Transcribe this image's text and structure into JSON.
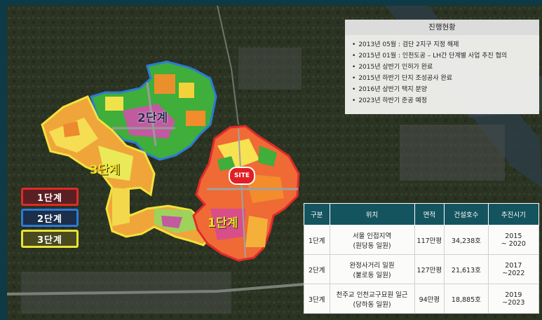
{
  "legend": {
    "phase1": "1단계",
    "phase2": "2단계",
    "phase3": "3단계"
  },
  "map_labels": {
    "phase1": "1단계",
    "phase2": "2단계",
    "phase3": "3단계",
    "site": "SITE"
  },
  "status": {
    "title": "진행현황",
    "items": [
      "2013년 05월 : 검단 2지구 지정 해제",
      "2015년 01월 : 인천도공 – LH간 단계별 사업 추진 협의",
      "2015년 상반기 인허가 완료",
      "2015년 하반기 단지 조성공사 완료",
      "2016년 상반기 택지 분양",
      "2023년 하반기 준공 예정"
    ]
  },
  "table": {
    "headers": [
      "구분",
      "위치",
      "면적",
      "건설호수",
      "추진시기"
    ],
    "rows": [
      {
        "phase": "1단계",
        "loc1": "서울 인접지역",
        "loc2": "(원당동 일원)",
        "area": "117만평",
        "units": "34,238호",
        "period1": "2015",
        "period2": "~ 2020"
      },
      {
        "phase": "2단계",
        "loc1": "완정사거리 일원",
        "loc2": "(불로동 일원)",
        "area": "127만평",
        "units": "21,613호",
        "period1": "2017",
        "period2": "~2022"
      },
      {
        "phase": "3단계",
        "loc1": "천주교 인천교구묘원 일근",
        "loc2": "(당하동 일원)",
        "area": "94만평",
        "units": "18,885호",
        "period1": "2019",
        "period2": "~2023"
      }
    ]
  },
  "colors": {
    "phase1": "#e02a2a",
    "phase2": "#2c7bd6",
    "phase3": "#e9e33a",
    "header": "#14545f"
  }
}
